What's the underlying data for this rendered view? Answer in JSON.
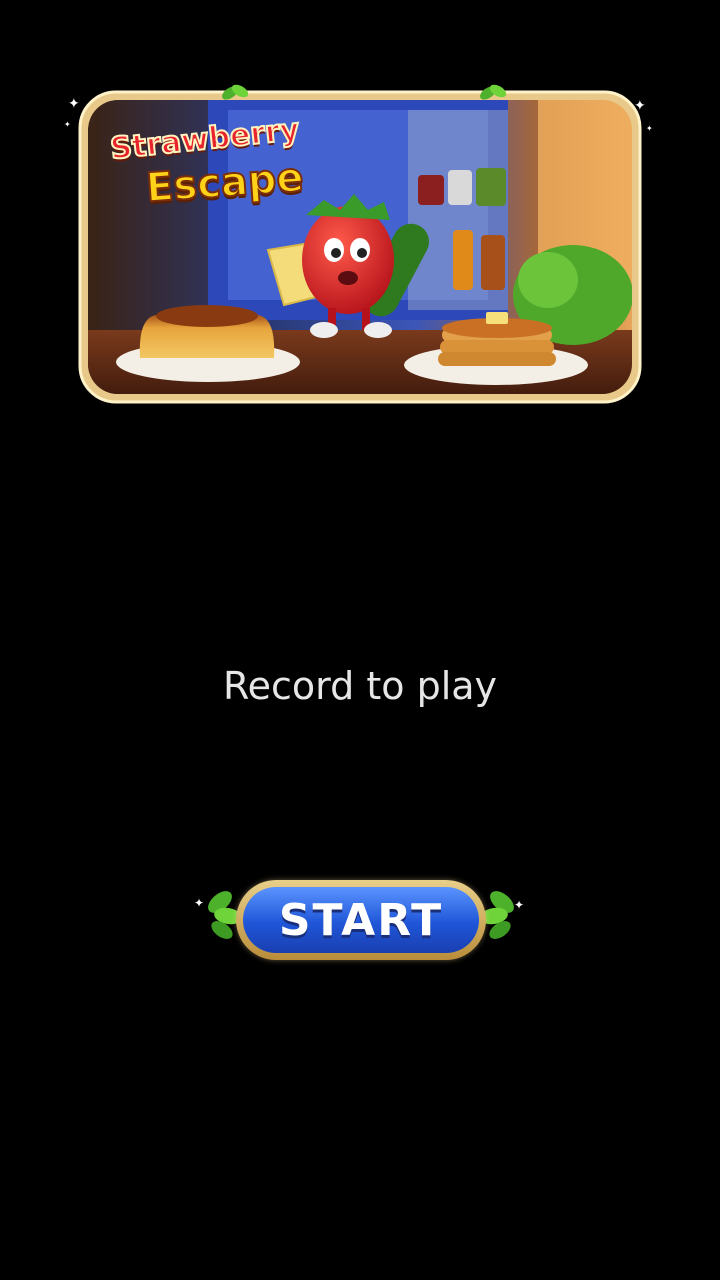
{
  "banner": {
    "logo_line1": "Strawberry",
    "logo_line2": "Escape",
    "icons": [
      "sparkle-icon",
      "leaf-icon"
    ]
  },
  "prompt_text": "Record to play",
  "start_button": {
    "label": "START"
  },
  "colors": {
    "background": "#000000",
    "frame_gold": "#e8c98a",
    "button_blue": "#1f56d8",
    "prompt_text": "#e6e6e6"
  }
}
